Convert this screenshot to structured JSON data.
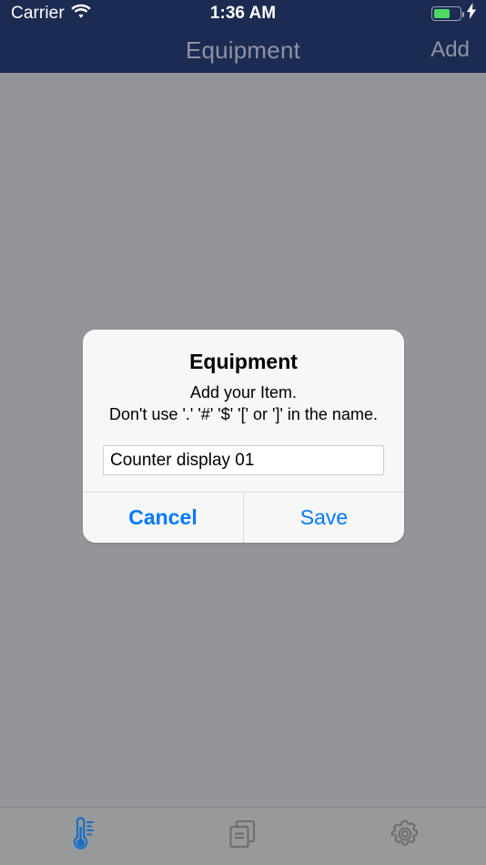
{
  "status_bar": {
    "carrier": "Carrier",
    "wifi_icon": "wifi-icon",
    "time": "1:36 AM",
    "battery_icon": "battery-icon",
    "charging_icon": "lightning-bolt-icon",
    "background_color": "#1c2b51",
    "battery_fill_color": "#4cd964"
  },
  "nav_bar": {
    "title": "Equipment",
    "add_label": "Add",
    "background_color": "#1c2b51",
    "text_color": "#8e93a3"
  },
  "overlay": {
    "color": "#939598"
  },
  "dialog": {
    "title": "Equipment",
    "message_line_1": "Add your Item.",
    "message_line_2": "Don't use '.' '#' '$' '[' or ']' in the name.",
    "input_value": "Counter display 01",
    "input_placeholder": "",
    "cancel_label": "Cancel",
    "save_label": "Save",
    "button_color": "#007aff",
    "background_color": "#f7f7f7"
  },
  "tab_bar": {
    "background_color": "#97999b",
    "active_color": "#1a6fc4",
    "inactive_color": "#6e7072",
    "items": [
      {
        "name": "thermometer-icon",
        "active": true
      },
      {
        "name": "documents-icon",
        "active": false
      },
      {
        "name": "gear-icon",
        "active": false
      }
    ]
  }
}
